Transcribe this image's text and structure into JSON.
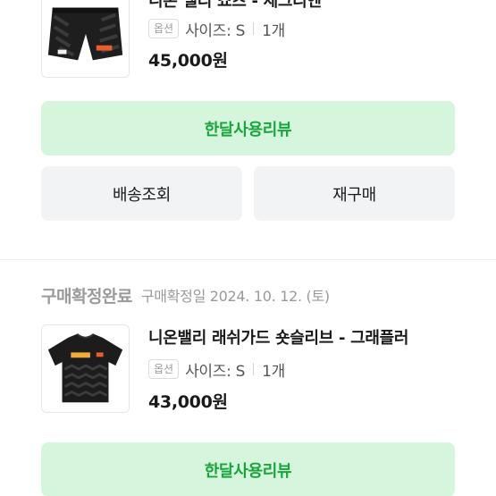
{
  "orders": [
    {
      "product_name": "니온 밸리 쇼츠 - 세그리엔",
      "option_tag": "옵션",
      "option_size": "사이즈: S",
      "quantity": "1개",
      "price": "45,000원",
      "review_label": "한달사용리뷰",
      "shipping_label": "배송조회",
      "reorder_label": "재구매"
    },
    {
      "status": "구매확정완료",
      "confirm_date": "구매확정일 2024. 10. 12. (토)",
      "product_name": "니온밸리 래쉬가드 숏슬리브 - 그래플러",
      "option_tag": "옵션",
      "option_size": "사이즈: S",
      "quantity": "1개",
      "price": "43,000원",
      "review_label": "한달사용리뷰"
    }
  ]
}
